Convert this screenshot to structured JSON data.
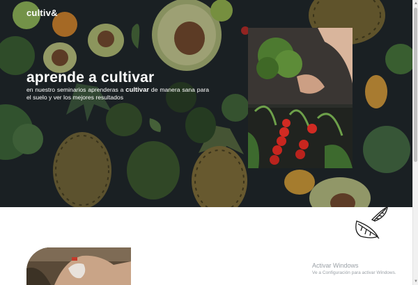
{
  "brand": {
    "logo_text": "cultiv&"
  },
  "hero": {
    "headline": "aprende a cultivar",
    "subtext_before": "en nuestro seminarios aprenderas a ",
    "subtext_bold": "cultivar",
    "subtext_after": " de manera sana para el suelo y ver los mejores resultados"
  },
  "icons": {
    "leaves": "leaves-icon",
    "scroll_up": "arrow-up-icon",
    "scroll_down": "arrow-down-icon"
  },
  "watermark": {
    "title": "Activar Windows",
    "subtitle": "Ve a Configuración para activar Windows."
  },
  "colors": {
    "hero_bg": "#1d2226",
    "text_light": "#ffffff",
    "watermark": "#9aa0a6"
  }
}
